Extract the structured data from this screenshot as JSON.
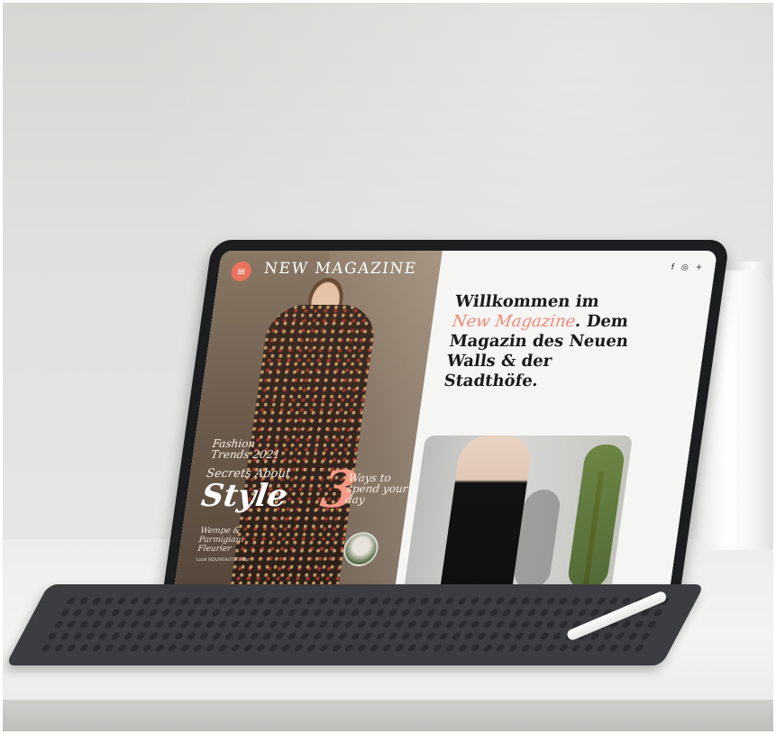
{
  "screen": {
    "brand": "NEW MAGAZINE",
    "menu_icon": "menu-icon",
    "social_icons": [
      "f",
      "◎",
      "+"
    ],
    "hero": {
      "fashion_label": "Fashion Trends 2021",
      "secrets_label": "Secrets About",
      "style_word": "Style",
      "authors": "Wempe & Parmigiani Fleurier",
      "credit": "Look NOUVEAUTÉ Shop",
      "number": "3",
      "ways_label": "Ways to spend your day"
    },
    "headline": {
      "line1": "Willkommen im ",
      "accent": "New Magazine",
      "line2": ". Dem Magazin des Neuen Walls & der Stadthöfe."
    }
  },
  "colors": {
    "accent": "#f08a74",
    "menu_button": "#e9735c"
  }
}
